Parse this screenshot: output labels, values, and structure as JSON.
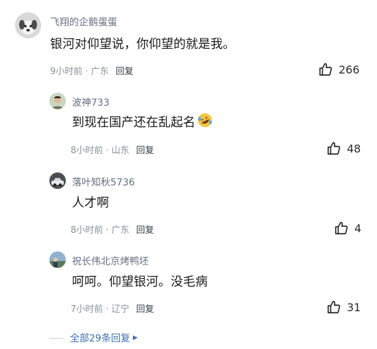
{
  "thread": {
    "main": {
      "author": "飞翔的企鹅蛋蛋",
      "text": "银河对仰望说，你仰望的就是我。",
      "time": "9小时前 · 广东",
      "reply_label": "回复",
      "likes": "266",
      "avatar_icon": "dog-avatar"
    },
    "replies": [
      {
        "author": "波神733",
        "text": "到现在国产还在乱起名",
        "emoji": "rofl-emoji",
        "time": "8小时前 · 山东",
        "reply_label": "回复",
        "likes": "48",
        "avatar_icon": "person-avatar"
      },
      {
        "author": "落叶知秋5736",
        "text": "人才啊",
        "time": "8小时前 · 广东",
        "reply_label": "回复",
        "likes": "4",
        "avatar_icon": "car-avatar"
      },
      {
        "author": "祝长伟北京烤鸭坯",
        "text": "呵呵。仰望银河。没毛病",
        "time": "7小时前 · 辽宁",
        "reply_label": "回复",
        "likes": "31",
        "avatar_icon": "scene-avatar"
      }
    ],
    "more_replies_label": "全部29条回复",
    "more_icon": "triangle-right-icon"
  },
  "colors": {
    "author": "#666f7f",
    "meta": "#8a8f99",
    "link": "#3b6fb6"
  }
}
